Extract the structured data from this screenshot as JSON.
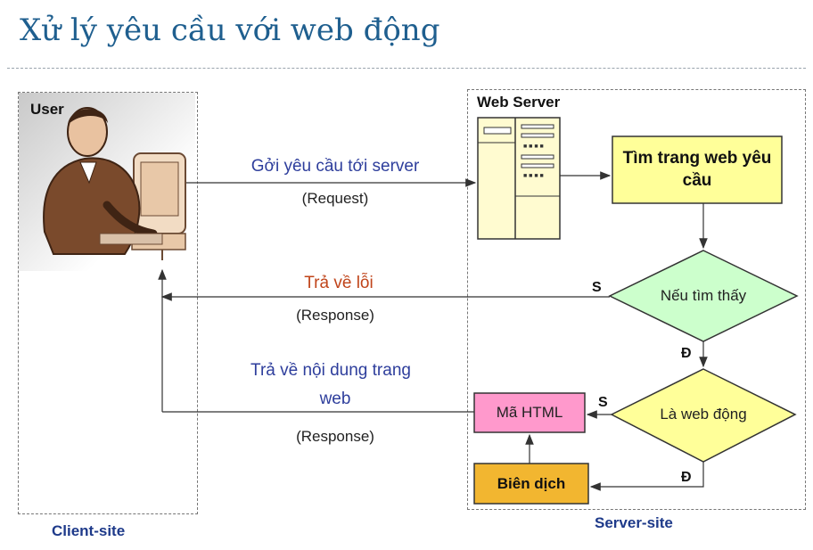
{
  "title": "Xử lý yêu cầu với web động",
  "client": {
    "user_label": "User",
    "site_label": "Client-site"
  },
  "server": {
    "web_server_label": "Web Server",
    "site_label": "Server-site"
  },
  "nodes": {
    "find_page": "Tìm trang web yêu cầu",
    "if_found": "Nếu tìm thấy",
    "is_dynamic": "Là web động",
    "html_code": "Mã HTML",
    "compile": "Biên dịch"
  },
  "arrows": {
    "request_text": "Gởi yêu cầu tới server",
    "request_sub": "(Request)",
    "error_text": "Trả về lỗi",
    "error_sub": "(Response)",
    "content_text_1": "Trả về nội dung trang",
    "content_text_2": "web",
    "content_sub": "(Response)",
    "s_label_1": "S",
    "d_label_1": "Đ",
    "s_label_2": "S",
    "d_label_2": "Đ"
  },
  "colors": {
    "title": "#1f5f8f",
    "blue_text": "#2e3e9c",
    "error_text": "#c0441a",
    "yellow_fill": "#ffff99",
    "green_fill": "#ccffcc",
    "pink_fill": "#ff99cc",
    "orange_fill": "#f2b630"
  }
}
